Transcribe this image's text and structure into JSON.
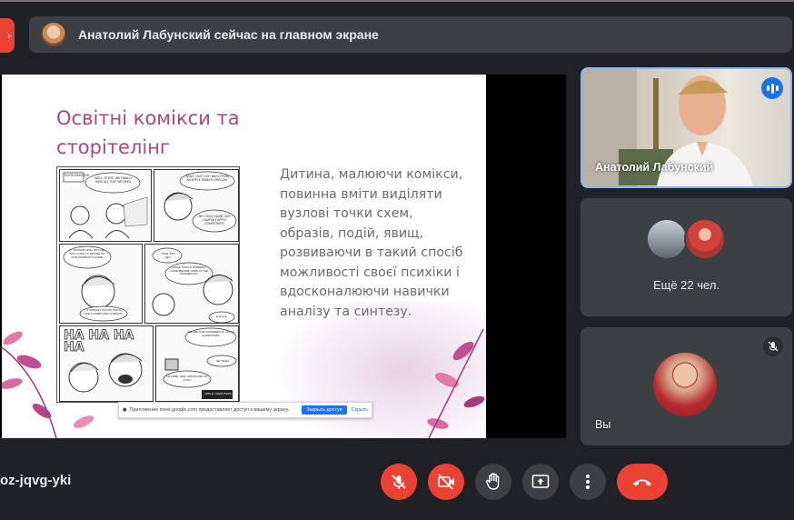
{
  "banner": {
    "presenter_text": "Анатолий Лабунский сейчас на главном экране"
  },
  "slide": {
    "title": "Освітні комікси та сторітелінг",
    "body": "Дитина, малюючи комікси, повинна вміти виділяти вузлові точки схем, образів, подій, явищ, розвиваючи в такий спосіб можливості своєї психіки і вдосконалюючи навички аналізу та синтезу.",
    "comic_caption_top": "SOON ENOUGH",
    "comic_sfx": "HA HA HA HA",
    "comic_bubbles": [
      "WELL, STEVE, WE FINALLY HAVE ALL THAT WE NEED.",
      "YEAH, I JUST GOT BACK FROM AN APPLE FARM IN OREGON.",
      "WE COULD NAME OUR COMPANY APPLE COMPUTERS!",
      "IT SOUNDS NICE, BUT WE STILL HAVE TO DECIDE ON OUR COMPANY'S NAME.",
      "TRUE, BUT HEY!",
      "'APPLE' WOULD PROBABLY COME BEFORE 'ATARI' IN THE PHONEBOOK!",
      "IT DOESN'T SOUND MUCH LIKE A COMPUTER COMPANY.",
      "WE ARE THE FOUNDERS OF APPLE COMPUTERS!",
      "AW YEAH!",
      "I'M SURE THAT CRACKS ME UP. COOL!",
      "APPLE COMPUTERS"
    ],
    "share_notice": {
      "text": "Приложение meet.google.com предоставляет доступ к вашему экрану.",
      "stop_label": "Закрыть доступ",
      "hide_label": "Скрыть"
    }
  },
  "participants": {
    "speaker_name": "Анатолий Лабунский",
    "others_label": "Ещё 22 чел.",
    "self_label": "Вы"
  },
  "meeting": {
    "code": "oz-jqvg-yki"
  },
  "controls": {
    "buttons": [
      "mic-off-icon",
      "camera-off-icon",
      "raise-hand-icon",
      "present-icon",
      "more-icon",
      "end-call-icon"
    ]
  },
  "colors": {
    "background": "#202124",
    "surface": "#3c4043",
    "danger": "#ea4335",
    "active_border": "#8ab4f8",
    "title_pink": "#b0467b"
  }
}
